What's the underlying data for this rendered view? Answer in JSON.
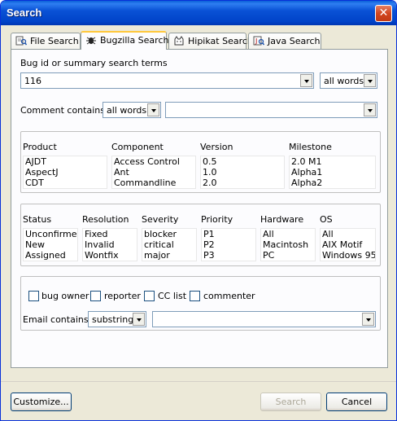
{
  "window": {
    "title": "Search",
    "close_symbol": "✕"
  },
  "tabs": [
    {
      "label": "File Search",
      "icon": "file-search-icon"
    },
    {
      "label": "Bugzilla Search",
      "icon": "bug-icon",
      "active": true
    },
    {
      "label": "Hipikat Search",
      "icon": "cat-icon"
    },
    {
      "label": "Java Search",
      "icon": "java-search-icon"
    }
  ],
  "bug_search": {
    "label": "Bug id or summary search terms",
    "value": "116",
    "mode": "all words"
  },
  "comment": {
    "label": "Comment contains:",
    "mode": "all words",
    "value": ""
  },
  "group1": {
    "columns": [
      {
        "header": "Product",
        "items": [
          "AJDT",
          "AspectJ",
          "CDT"
        ]
      },
      {
        "header": "Component",
        "items": [
          "Access Control",
          "Ant",
          "Commandline"
        ]
      },
      {
        "header": "Version",
        "items": [
          "0.5",
          "1.0",
          "2.0"
        ]
      },
      {
        "header": "Milestone",
        "items": [
          "2.0 M1",
          "Alpha1",
          "Alpha2"
        ]
      }
    ]
  },
  "group2": {
    "columns": [
      {
        "header": "Status",
        "items": [
          "Unconfirmed",
          "New",
          "Assigned"
        ]
      },
      {
        "header": "Resolution",
        "items": [
          "Fixed",
          "Invalid",
          "Wontfix"
        ]
      },
      {
        "header": "Severity",
        "items": [
          "blocker",
          "critical",
          "major"
        ]
      },
      {
        "header": "Priority",
        "items": [
          "P1",
          "P2",
          "P3"
        ]
      },
      {
        "header": "Hardware",
        "items": [
          "All",
          "Macintosh",
          "PC"
        ]
      },
      {
        "header": "OS",
        "items": [
          "All",
          "AIX Motif",
          "Windows 95"
        ]
      }
    ]
  },
  "email": {
    "checkboxes": [
      "bug owner",
      "reporter",
      "CC list",
      "commenter"
    ],
    "label": "Email contains:",
    "mode": "substring",
    "value": ""
  },
  "buttons": {
    "customize": "Customize...",
    "search": "Search",
    "cancel": "Cancel"
  }
}
